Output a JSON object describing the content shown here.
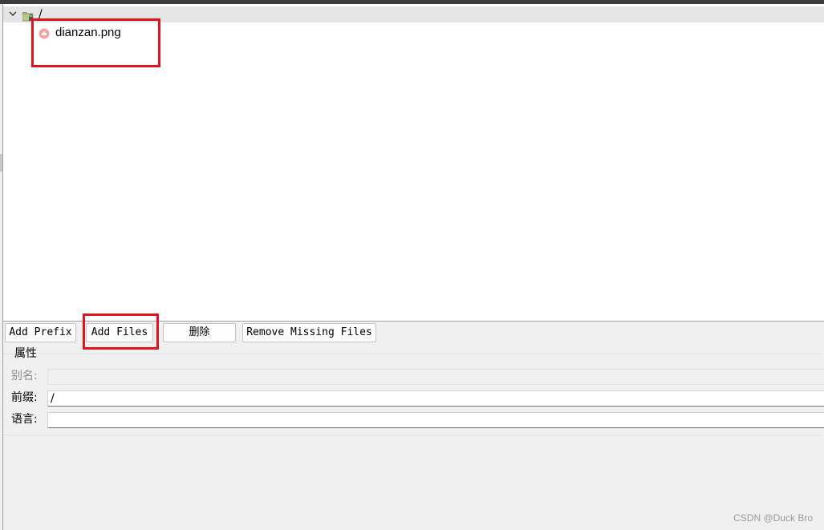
{
  "tree": {
    "root_label": "/",
    "file_label": "dianzan.png"
  },
  "toolbar": {
    "add_prefix_label": "Add Prefix",
    "add_files_label": "Add Files",
    "delete_label": "删除",
    "remove_missing_label": "Remove Missing Files"
  },
  "properties": {
    "title": "属性",
    "alias_label": "别名:",
    "alias_value": "",
    "prefix_label": "前缀:",
    "prefix_value": "/",
    "language_label": "语言:",
    "language_value": ""
  },
  "watermark": "CSDN @Duck Bro",
  "colors": {
    "highlight_box": "#e0141e",
    "root_row_bg": "#e5e5e5",
    "panel_bg": "#f0f0f0"
  },
  "icons": {
    "expand": "chevron-down-icon",
    "root": "folder-lock-icon",
    "file": "image-file-icon"
  }
}
